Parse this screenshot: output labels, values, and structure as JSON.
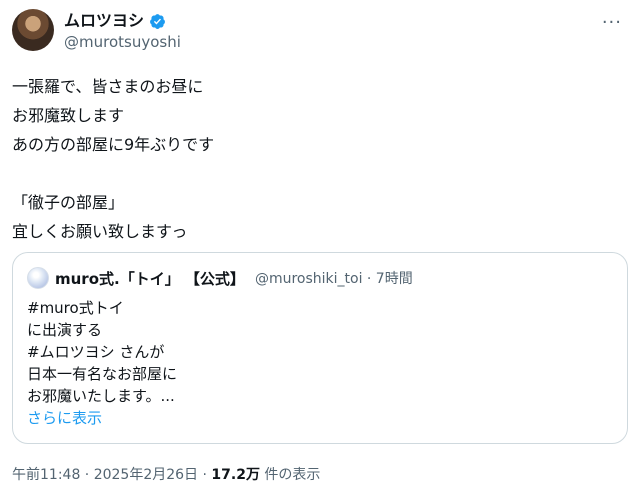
{
  "author": {
    "display_name": "ムロツヨシ",
    "handle": "@murotsuyoshi",
    "verified_icon": "verified-badge-icon",
    "verified_color": "#1d9bf0"
  },
  "more_icon": "more-options-icon",
  "more_symbol": "···",
  "tweet": {
    "lines": [
      "一張羅で、皆さまのお昼に",
      "お邪魔致します",
      "あの方の部屋に9年ぶりです",
      "",
      "「徹子の部屋」",
      "宜しくお願い致しますっ"
    ]
  },
  "quote": {
    "display_name": "muro式.「トイ」 【公式】",
    "handle_time": "@muroshiki_toi · 7時間",
    "lines": [
      "#muro式トイ",
      "に出演する",
      "#ムロツヨシ さんが",
      "日本一有名なお部屋に",
      "お邪魔いたします。..."
    ],
    "show_more": "さらに表示",
    "show_more_color": "#1d9bf0"
  },
  "meta": {
    "time": "午前11:48 · 2025年2月26日 · ",
    "views": "17.2万",
    "views_label": " 件の表示"
  }
}
